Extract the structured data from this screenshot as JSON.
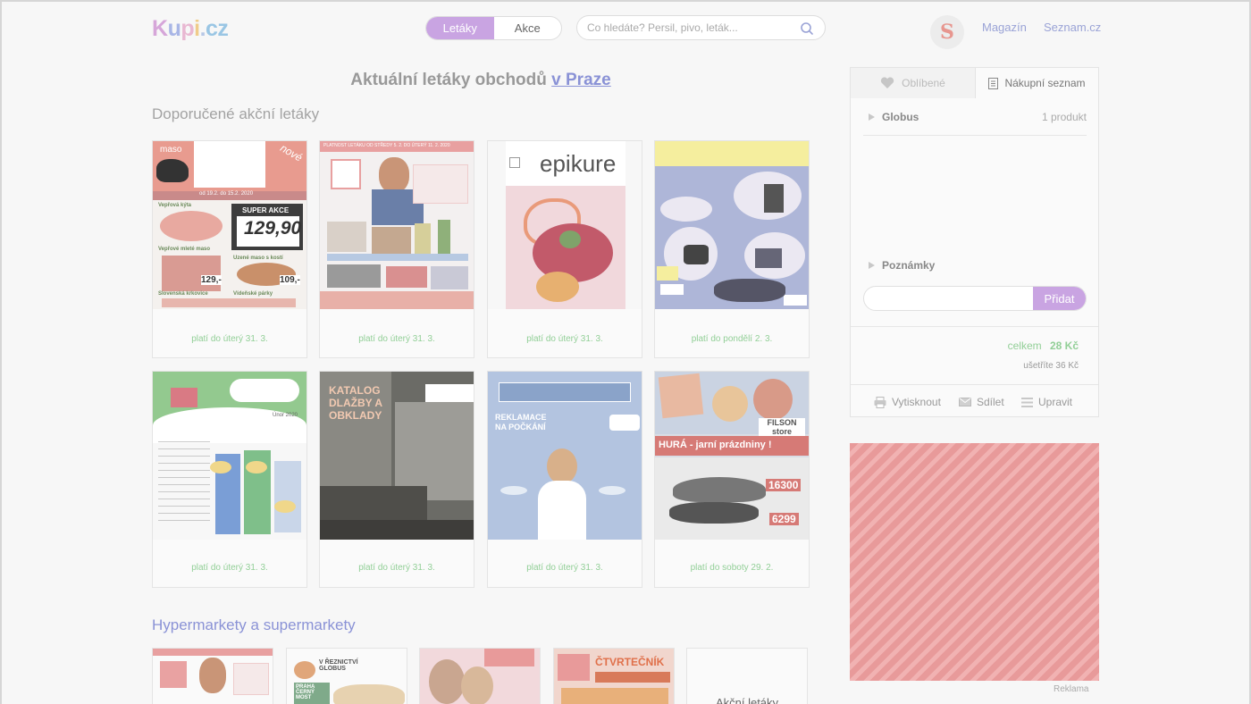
{
  "header": {
    "logo": {
      "k": "K",
      "u": "u",
      "p": "p",
      "i": "i",
      "dot": ".",
      "cz": "cz"
    },
    "tabs": [
      {
        "label": "Letáky",
        "active": true
      },
      {
        "label": "Akce",
        "active": false
      }
    ],
    "search_placeholder": "Co hledáte? Persil, pivo, leták...",
    "seznam_logo": "S",
    "links": [
      "Magazín",
      "Seznam.cz"
    ]
  },
  "main": {
    "title": "Aktuální letáky obchodů",
    "title_link": "v Praze",
    "recommended_heading": "Doporučené akční letáky",
    "flyers": [
      {
        "validity": "platí do úterý 31. 3."
      },
      {
        "validity": "platí do úterý 31. 3."
      },
      {
        "validity": "platí do úterý 31. 3."
      },
      {
        "validity": "platí do pondělí 2. 3."
      },
      {
        "validity": "platí do úterý 31. 3."
      },
      {
        "validity": "platí do úterý 31. 3."
      },
      {
        "validity": "platí do úterý 31. 3."
      },
      {
        "validity": "platí do soboty 29. 2."
      }
    ],
    "flyer_texts": {
      "f1_maso": "maso",
      "f1_nove": "nové",
      "f1_date": "od 19.2. do 15.2. 2020",
      "f1_super": "SUPER AKCE",
      "f1_price": "129,90",
      "f1_p2": "129,-",
      "f1_p3": "109,-",
      "f1_l1": "Vepřová kýta",
      "f1_l2": "Vepřové mleté maso",
      "f1_l3": "Uzené maso s kostí",
      "f1_l4": "Slovenská krkovice",
      "f1_l5": "Vídeňské párky",
      "f2_top": "PLATNOST LETÁKU OD STŘEDY 5. 2. DO ÚTERÝ 11. 2. 2020",
      "f3_brand": "epikure",
      "f5_month": "Únor 2020",
      "f6_text": "KATALOG DLAŽBY A OBKLADY",
      "f7_text": "REKLAMACE NA POČKÁNÍ",
      "f8_brand": "FILSON store",
      "f8_text": "HURÁ - jarní prázdniny !",
      "f8_p1": "16300",
      "f8_p2": "6299"
    },
    "hyper_heading": "Hypermarkety a supermarkety",
    "mini_texts": {
      "m2_title": "V ŘEZNICTVÍ GLOBUS",
      "m2_sub": "PRAHA ČERNÝ MOST",
      "m4_title": "ČTVRTEČNÍK"
    },
    "more_label": "Akční letáky"
  },
  "sidebar": {
    "tabs": [
      {
        "label": "Oblíbené"
      },
      {
        "label": "Nákupní seznam"
      }
    ],
    "store": {
      "name": "Globus",
      "count": "1 produkt"
    },
    "notes_label": "Poznámky",
    "add_button": "Přidat",
    "total_label": "celkem",
    "total_value": "28 Kč",
    "savings": "ušetříte 36 Kč",
    "actions": [
      "Vytisknout",
      "Sdílet",
      "Upravit"
    ]
  },
  "ad": {
    "label": "Reklama"
  },
  "colors": {
    "accent": "#c9a4e2",
    "link": "#8a92d6",
    "validity_green": "#92cf97",
    "heading_blue": "#8a92d6"
  }
}
